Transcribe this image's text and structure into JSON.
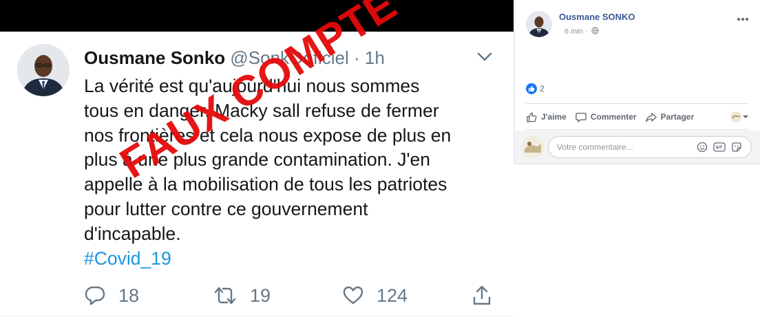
{
  "tweet": {
    "author_name": "Ousmane Sonko",
    "handle": "@SonkOoficiel",
    "separator": "·",
    "time": "1h",
    "text": "La vérité est qu'aujourd'hui nous  sommes\ntous en danger. Macky sall refuse de fermer\nnos frontières et cela nous expose de plus en\nplus à une plus grande contamination. J'en\nappelle à la mobilisation de tous les patriotes\npour lutter contre ce gouvernement\nd'incapable.",
    "hashtag": "#Covid_19",
    "replies": "18",
    "retweets": "19",
    "likes": "124",
    "stamp": "FAUX COMPTE",
    "icons": {
      "reply": "reply-icon",
      "retweet": "retweet-icon",
      "like": "heart-icon",
      "share": "share-icon",
      "caret": "chevron-down-icon"
    },
    "colors": {
      "hashtag": "#1b95e0",
      "stamp": "#e50a0a",
      "muted": "#657786"
    }
  },
  "facebook": {
    "author_name": "Ousmane SONKO",
    "time": "6 min",
    "separator": "·",
    "reaction_count": "2",
    "actions": {
      "like": "J'aime",
      "comment": "Commenter",
      "share": "Partager"
    },
    "comment_placeholder": "Votre commentaire...",
    "icons": {
      "more": "more-icon",
      "audience": "globe-icon",
      "reaction": "like-reaction-icon",
      "emoji": "emoji-icon",
      "gif": "gif-icon",
      "sticker": "sticker-icon"
    },
    "colors": {
      "author": "#385898",
      "reaction": "#1877f2"
    }
  }
}
